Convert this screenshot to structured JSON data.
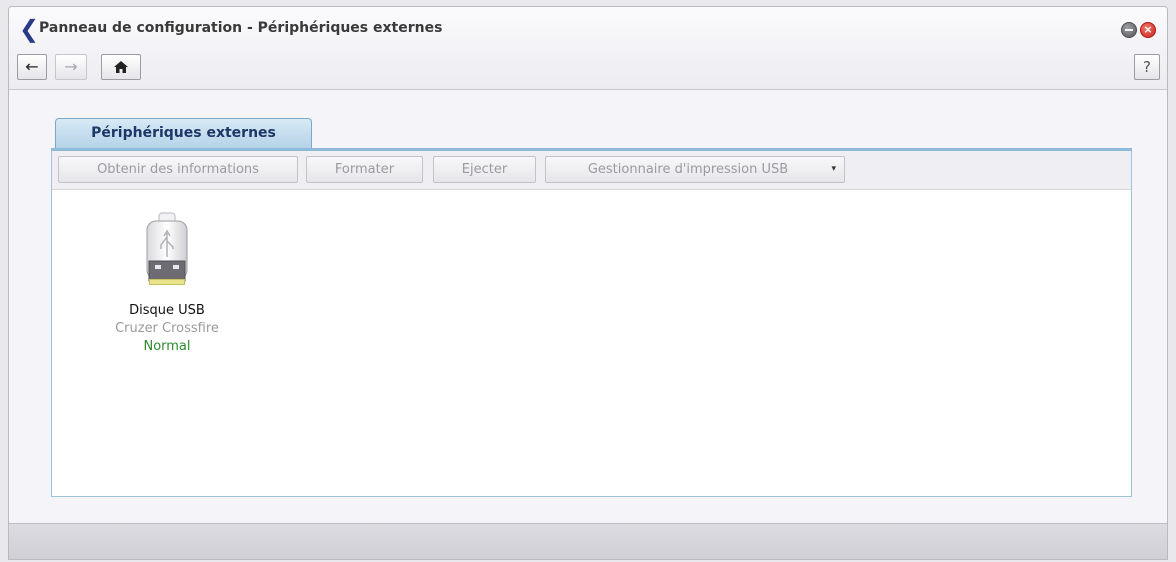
{
  "window": {
    "title": "Panneau de configuration - Périphériques externes",
    "minimize_symbol": "",
    "close_symbol": "×"
  },
  "nav": {
    "back_symbol": "←",
    "forward_symbol": "→",
    "home_symbol": "⌂",
    "help_symbol": "?"
  },
  "tabs": [
    {
      "label": "Périphériques externes",
      "active": true
    }
  ],
  "toolbar": {
    "info_label": "Obtenir des informations",
    "format_label": "Formater",
    "eject_label": "Ejecter",
    "usb_print_label": "Gestionnaire d'impression USB",
    "dropdown_caret": "▾"
  },
  "devices": [
    {
      "name": "Disque USB",
      "model": "Cruzer Crossfire",
      "status": "Normal",
      "icon": "usb-drive-icon"
    }
  ],
  "colors": {
    "title_caret": "#2b3a86",
    "tab_bg": "#c6def0",
    "status_normal": "#2c8a2c",
    "close_button": "#d9362c"
  }
}
